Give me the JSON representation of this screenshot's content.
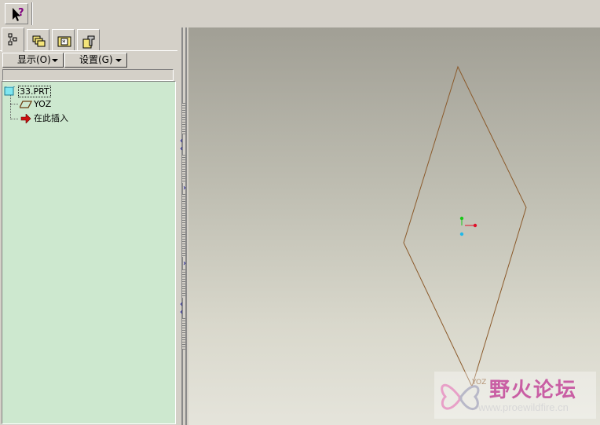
{
  "toolbar": {
    "help_icon": "whats-this-help-icon"
  },
  "navigator": {
    "tabs": [
      {
        "name": "model-tree-tab",
        "icon": "model-tree-icon",
        "active": true
      },
      {
        "name": "folder-browser-tab",
        "icon": "folders-icon",
        "active": false
      },
      {
        "name": "favorites-tab",
        "icon": "favorites-icon",
        "active": false
      },
      {
        "name": "connections-tab",
        "icon": "connections-icon",
        "active": false
      }
    ],
    "show_menu_label": "显示(O)",
    "settings_menu_label": "设置(G)"
  },
  "tree": {
    "items": [
      {
        "label": "33.PRT",
        "icon": "part-icon"
      },
      {
        "label": "YOZ",
        "icon": "datum-plane-icon"
      },
      {
        "label": "在此插入",
        "icon": "insert-here-arrow-icon"
      }
    ]
  },
  "viewport": {
    "plane_label": "YOZ",
    "plane_color": "#8b5a2b",
    "axis_colors": {
      "x": "#e0102a",
      "y": "#18c818",
      "z": "#20b8e8"
    }
  },
  "watermark": {
    "title": "野火论坛",
    "url": "www.proewildfire.cn"
  }
}
